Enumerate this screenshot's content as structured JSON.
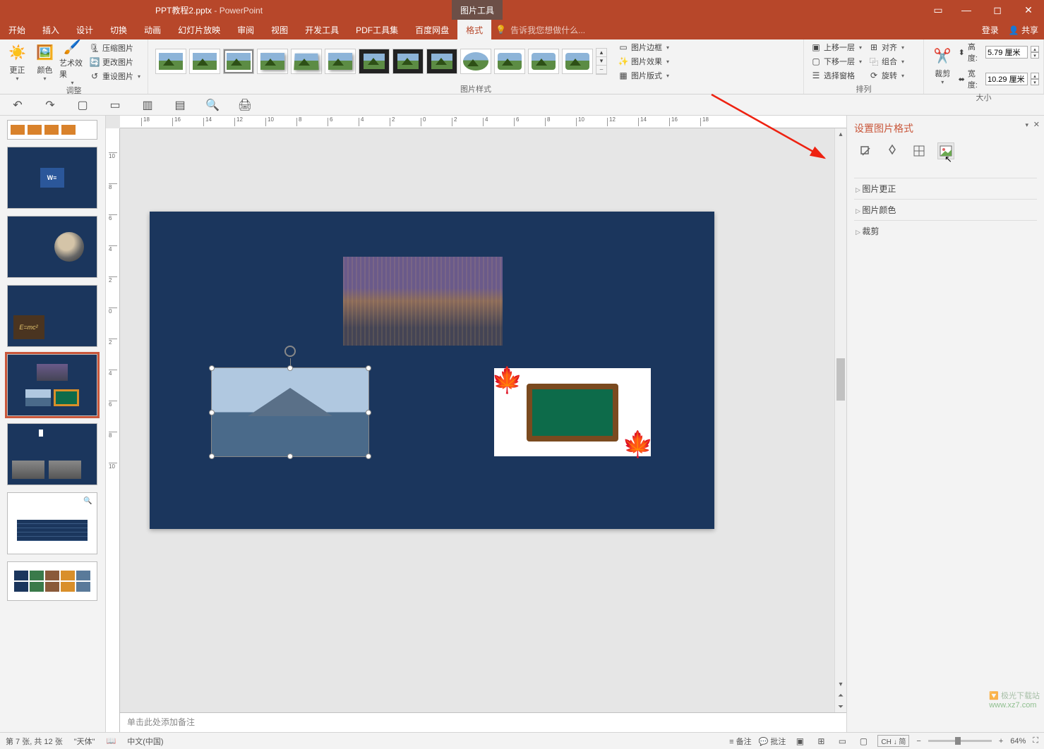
{
  "title": {
    "filename": "PPT教程2.pptx",
    "sep": " - ",
    "app": "PowerPoint",
    "contextual": "图片工具"
  },
  "tabs": {
    "items": [
      "开始",
      "插入",
      "设计",
      "切换",
      "动画",
      "幻灯片放映",
      "审阅",
      "视图",
      "开发工具",
      "PDF工具集",
      "百度网盘",
      "格式"
    ],
    "activeIndex": 11,
    "tell": "告诉我您想做什么...",
    "login": "登录",
    "share": "共享"
  },
  "ribbon": {
    "adjust": {
      "corrections": "更正",
      "color": "颜色",
      "artistic": "艺术效果",
      "compress": "压缩图片",
      "change": "更改图片",
      "reset": "重设图片",
      "group": "调整"
    },
    "styles": {
      "border": "图片边框",
      "effects": "图片效果",
      "layout": "图片版式",
      "group": "图片样式"
    },
    "arrange": {
      "forward": "上移一层",
      "backward": "下移一层",
      "pane": "选择窗格",
      "align": "对齐",
      "group_btn": "组合",
      "rotate": "旋转",
      "group": "排列"
    },
    "size": {
      "crop": "裁剪",
      "height_lbl": "高度:",
      "height_val": "5.79 厘米",
      "width_lbl": "宽度:",
      "width_val": "10.29 厘米",
      "group": "大小"
    }
  },
  "fmtpane": {
    "title": "设置图片格式",
    "sec1": "图片更正",
    "sec2": "图片颜色",
    "sec3": "裁剪"
  },
  "notes": {
    "placeholder": "单击此处添加备注"
  },
  "status": {
    "slide": "第 7 张, 共 12 张",
    "theme": "\"天体\"",
    "lang": "中文(中国)",
    "notes": "备注",
    "comments": "批注",
    "ime": "CH ↓ 简",
    "zoom": "64%"
  },
  "watermark": {
    "site": "极光下载站",
    "url": "www.xz7.com"
  }
}
